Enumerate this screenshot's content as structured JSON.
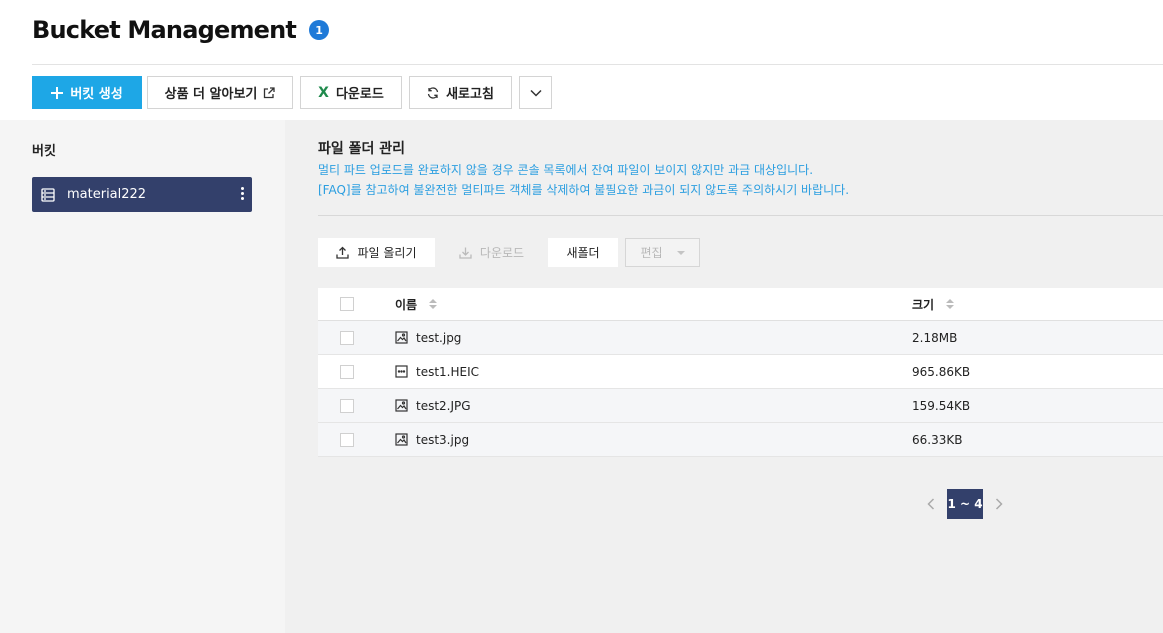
{
  "header": {
    "title": "Bucket Management",
    "badge": "1"
  },
  "toolbar": {
    "create_label": "버킷 생성",
    "learn_more_label": "상품 더 알아보기",
    "download_label": "다운로드",
    "refresh_label": "새로고침"
  },
  "sidebar": {
    "title": "버킷",
    "buckets": [
      {
        "name": "material222"
      }
    ]
  },
  "main": {
    "section_title": "파일 폴더 관리",
    "notice_line1": "멀티 파트 업로드를 완료하지 않을 경우 콘솔 목록에서 잔여 파일이 보이지 않지만 과금 대상입니다.",
    "notice_line2": "[FAQ]를 참고하여 불완전한 멀티파트 객체를 삭제하여 불필요한 과금이 되지 않도록 주의하시기 바랍니다.",
    "file_toolbar": {
      "upload_label": "파일 올리기",
      "download_label": "다운로드",
      "new_folder_label": "새폴더",
      "edit_label": "편집"
    },
    "table": {
      "columns": {
        "name": "이름",
        "size": "크기"
      },
      "rows": [
        {
          "name": "test.jpg",
          "size": "2.18MB",
          "icon": "image-file-icon"
        },
        {
          "name": "test1.HEIC",
          "size": "965.86KB",
          "icon": "generic-file-icon"
        },
        {
          "name": "test2.JPG",
          "size": "159.54KB",
          "icon": "image-file-icon"
        },
        {
          "name": "test3.jpg",
          "size": "66.33KB",
          "icon": "image-file-icon"
        }
      ]
    },
    "pagination": {
      "current": "1 ~ 4"
    }
  },
  "colors": {
    "primary": "#1ea7e6",
    "bucket_selected": "#33406b",
    "notice": "#2b9ee0",
    "badge": "#1f7ad8"
  }
}
